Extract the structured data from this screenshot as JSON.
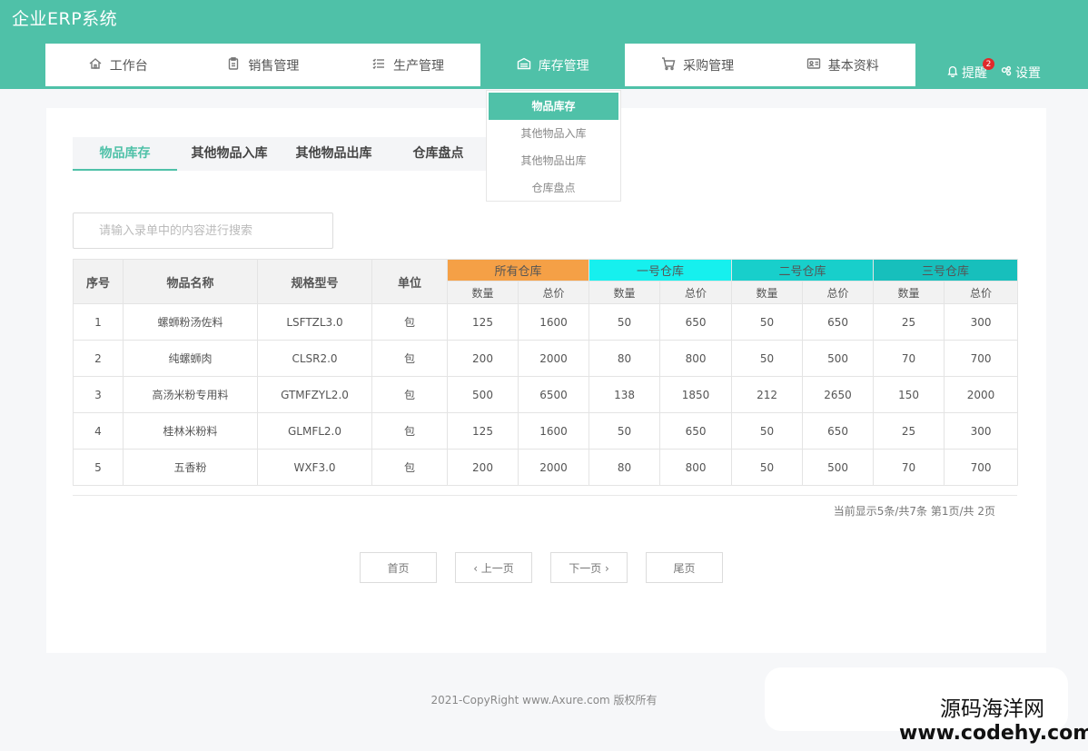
{
  "app": {
    "title": "企业ERP系统"
  },
  "nav": {
    "items": [
      {
        "label": "工作台",
        "icon": "home-icon"
      },
      {
        "label": "销售管理",
        "icon": "clipboard-icon"
      },
      {
        "label": "生产管理",
        "icon": "list-icon"
      },
      {
        "label": "库存管理",
        "icon": "warehouse-icon"
      },
      {
        "label": "采购管理",
        "icon": "cart-icon"
      },
      {
        "label": "基本资料",
        "icon": "id-card-icon"
      }
    ],
    "active": "库存管理"
  },
  "header_right": {
    "remind_label": "提醒",
    "remind_count": "2",
    "settings_label": "设置"
  },
  "dropdown": {
    "items": [
      "物品库存",
      "其他物品入库",
      "其他物品出库",
      "仓库盘点"
    ]
  },
  "tabs": [
    "物品库存",
    "其他物品入库",
    "其他物品出库",
    "仓库盘点"
  ],
  "search": {
    "placeholder": "请输入录单中的内容进行搜索"
  },
  "table": {
    "fixed_headers": [
      "序号",
      "物品名称",
      "规格型号",
      "单位"
    ],
    "warehouses": [
      "所有仓库",
      "一号仓库",
      "二号仓库",
      "三号仓库"
    ],
    "sub_headers": [
      "数量",
      "总价"
    ],
    "rows": [
      [
        "1",
        "螺蛳粉汤佐料",
        "LSFTZL3.0",
        "包",
        "125",
        "1600",
        "50",
        "650",
        "50",
        "650",
        "25",
        "300"
      ],
      [
        "2",
        "纯螺蛳肉",
        "CLSR2.0",
        "包",
        "200",
        "2000",
        "80",
        "800",
        "50",
        "500",
        "70",
        "700"
      ],
      [
        "3",
        "高汤米粉专用料",
        "GTMFZYL2.0",
        "包",
        "500",
        "6500",
        "138",
        "1850",
        "212",
        "2650",
        "150",
        "2000"
      ],
      [
        "4",
        "桂林米粉料",
        "GLMFL2.0",
        "包",
        "125",
        "1600",
        "50",
        "650",
        "50",
        "650",
        "25",
        "300"
      ],
      [
        "5",
        "五香粉",
        "WXF3.0",
        "包",
        "200",
        "2000",
        "80",
        "800",
        "50",
        "500",
        "70",
        "700"
      ]
    ]
  },
  "pagination": {
    "info": "当前显示5条/共7条 第1页/共 2页",
    "first": "首页",
    "prev": "‹ 上一页",
    "next": "下一页 ›",
    "last": "尾页"
  },
  "footer": {
    "copyright": "2021-CopyRight www.Axure.com 版权所有"
  },
  "watermark": {
    "line1": "源码海洋网",
    "line2": "www.codehy.com"
  },
  "colors": {
    "accent": "#4fc1a8",
    "wh_all": "#f5a046",
    "wh_1": "#16f0ee",
    "wh_2": "#18cfcb",
    "wh_3": "#17bfbc"
  }
}
